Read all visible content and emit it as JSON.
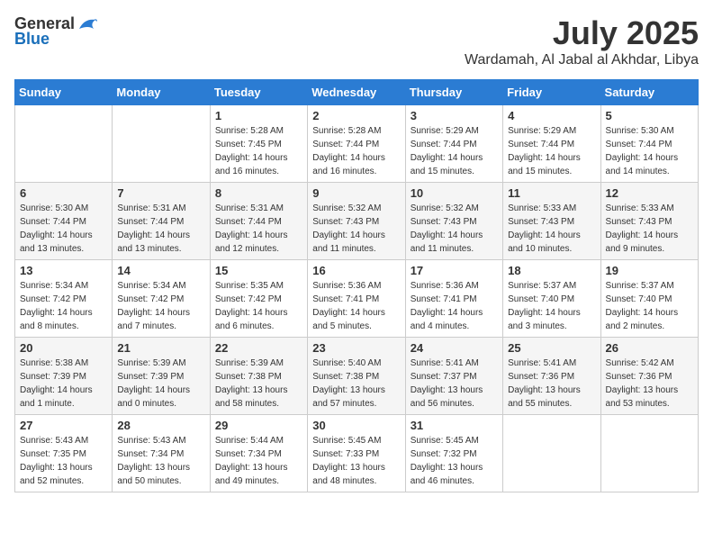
{
  "logo": {
    "text_general": "General",
    "text_blue": "Blue"
  },
  "title": "July 2025",
  "location": "Wardamah, Al Jabal al Akhdar, Libya",
  "days_of_week": [
    "Sunday",
    "Monday",
    "Tuesday",
    "Wednesday",
    "Thursday",
    "Friday",
    "Saturday"
  ],
  "weeks": [
    [
      {
        "day": null,
        "sunrise": null,
        "sunset": null,
        "daylight": null
      },
      {
        "day": null,
        "sunrise": null,
        "sunset": null,
        "daylight": null
      },
      {
        "day": "1",
        "sunrise": "Sunrise: 5:28 AM",
        "sunset": "Sunset: 7:45 PM",
        "daylight": "Daylight: 14 hours and 16 minutes."
      },
      {
        "day": "2",
        "sunrise": "Sunrise: 5:28 AM",
        "sunset": "Sunset: 7:44 PM",
        "daylight": "Daylight: 14 hours and 16 minutes."
      },
      {
        "day": "3",
        "sunrise": "Sunrise: 5:29 AM",
        "sunset": "Sunset: 7:44 PM",
        "daylight": "Daylight: 14 hours and 15 minutes."
      },
      {
        "day": "4",
        "sunrise": "Sunrise: 5:29 AM",
        "sunset": "Sunset: 7:44 PM",
        "daylight": "Daylight: 14 hours and 15 minutes."
      },
      {
        "day": "5",
        "sunrise": "Sunrise: 5:30 AM",
        "sunset": "Sunset: 7:44 PM",
        "daylight": "Daylight: 14 hours and 14 minutes."
      }
    ],
    [
      {
        "day": "6",
        "sunrise": "Sunrise: 5:30 AM",
        "sunset": "Sunset: 7:44 PM",
        "daylight": "Daylight: 14 hours and 13 minutes."
      },
      {
        "day": "7",
        "sunrise": "Sunrise: 5:31 AM",
        "sunset": "Sunset: 7:44 PM",
        "daylight": "Daylight: 14 hours and 13 minutes."
      },
      {
        "day": "8",
        "sunrise": "Sunrise: 5:31 AM",
        "sunset": "Sunset: 7:44 PM",
        "daylight": "Daylight: 14 hours and 12 minutes."
      },
      {
        "day": "9",
        "sunrise": "Sunrise: 5:32 AM",
        "sunset": "Sunset: 7:43 PM",
        "daylight": "Daylight: 14 hours and 11 minutes."
      },
      {
        "day": "10",
        "sunrise": "Sunrise: 5:32 AM",
        "sunset": "Sunset: 7:43 PM",
        "daylight": "Daylight: 14 hours and 11 minutes."
      },
      {
        "day": "11",
        "sunrise": "Sunrise: 5:33 AM",
        "sunset": "Sunset: 7:43 PM",
        "daylight": "Daylight: 14 hours and 10 minutes."
      },
      {
        "day": "12",
        "sunrise": "Sunrise: 5:33 AM",
        "sunset": "Sunset: 7:43 PM",
        "daylight": "Daylight: 14 hours and 9 minutes."
      }
    ],
    [
      {
        "day": "13",
        "sunrise": "Sunrise: 5:34 AM",
        "sunset": "Sunset: 7:42 PM",
        "daylight": "Daylight: 14 hours and 8 minutes."
      },
      {
        "day": "14",
        "sunrise": "Sunrise: 5:34 AM",
        "sunset": "Sunset: 7:42 PM",
        "daylight": "Daylight: 14 hours and 7 minutes."
      },
      {
        "day": "15",
        "sunrise": "Sunrise: 5:35 AM",
        "sunset": "Sunset: 7:42 PM",
        "daylight": "Daylight: 14 hours and 6 minutes."
      },
      {
        "day": "16",
        "sunrise": "Sunrise: 5:36 AM",
        "sunset": "Sunset: 7:41 PM",
        "daylight": "Daylight: 14 hours and 5 minutes."
      },
      {
        "day": "17",
        "sunrise": "Sunrise: 5:36 AM",
        "sunset": "Sunset: 7:41 PM",
        "daylight": "Daylight: 14 hours and 4 minutes."
      },
      {
        "day": "18",
        "sunrise": "Sunrise: 5:37 AM",
        "sunset": "Sunset: 7:40 PM",
        "daylight": "Daylight: 14 hours and 3 minutes."
      },
      {
        "day": "19",
        "sunrise": "Sunrise: 5:37 AM",
        "sunset": "Sunset: 7:40 PM",
        "daylight": "Daylight: 14 hours and 2 minutes."
      }
    ],
    [
      {
        "day": "20",
        "sunrise": "Sunrise: 5:38 AM",
        "sunset": "Sunset: 7:39 PM",
        "daylight": "Daylight: 14 hours and 1 minute."
      },
      {
        "day": "21",
        "sunrise": "Sunrise: 5:39 AM",
        "sunset": "Sunset: 7:39 PM",
        "daylight": "Daylight: 14 hours and 0 minutes."
      },
      {
        "day": "22",
        "sunrise": "Sunrise: 5:39 AM",
        "sunset": "Sunset: 7:38 PM",
        "daylight": "Daylight: 13 hours and 58 minutes."
      },
      {
        "day": "23",
        "sunrise": "Sunrise: 5:40 AM",
        "sunset": "Sunset: 7:38 PM",
        "daylight": "Daylight: 13 hours and 57 minutes."
      },
      {
        "day": "24",
        "sunrise": "Sunrise: 5:41 AM",
        "sunset": "Sunset: 7:37 PM",
        "daylight": "Daylight: 13 hours and 56 minutes."
      },
      {
        "day": "25",
        "sunrise": "Sunrise: 5:41 AM",
        "sunset": "Sunset: 7:36 PM",
        "daylight": "Daylight: 13 hours and 55 minutes."
      },
      {
        "day": "26",
        "sunrise": "Sunrise: 5:42 AM",
        "sunset": "Sunset: 7:36 PM",
        "daylight": "Daylight: 13 hours and 53 minutes."
      }
    ],
    [
      {
        "day": "27",
        "sunrise": "Sunrise: 5:43 AM",
        "sunset": "Sunset: 7:35 PM",
        "daylight": "Daylight: 13 hours and 52 minutes."
      },
      {
        "day": "28",
        "sunrise": "Sunrise: 5:43 AM",
        "sunset": "Sunset: 7:34 PM",
        "daylight": "Daylight: 13 hours and 50 minutes."
      },
      {
        "day": "29",
        "sunrise": "Sunrise: 5:44 AM",
        "sunset": "Sunset: 7:34 PM",
        "daylight": "Daylight: 13 hours and 49 minutes."
      },
      {
        "day": "30",
        "sunrise": "Sunrise: 5:45 AM",
        "sunset": "Sunset: 7:33 PM",
        "daylight": "Daylight: 13 hours and 48 minutes."
      },
      {
        "day": "31",
        "sunrise": "Sunrise: 5:45 AM",
        "sunset": "Sunset: 7:32 PM",
        "daylight": "Daylight: 13 hours and 46 minutes."
      },
      {
        "day": null,
        "sunrise": null,
        "sunset": null,
        "daylight": null
      },
      {
        "day": null,
        "sunrise": null,
        "sunset": null,
        "daylight": null
      }
    ]
  ]
}
